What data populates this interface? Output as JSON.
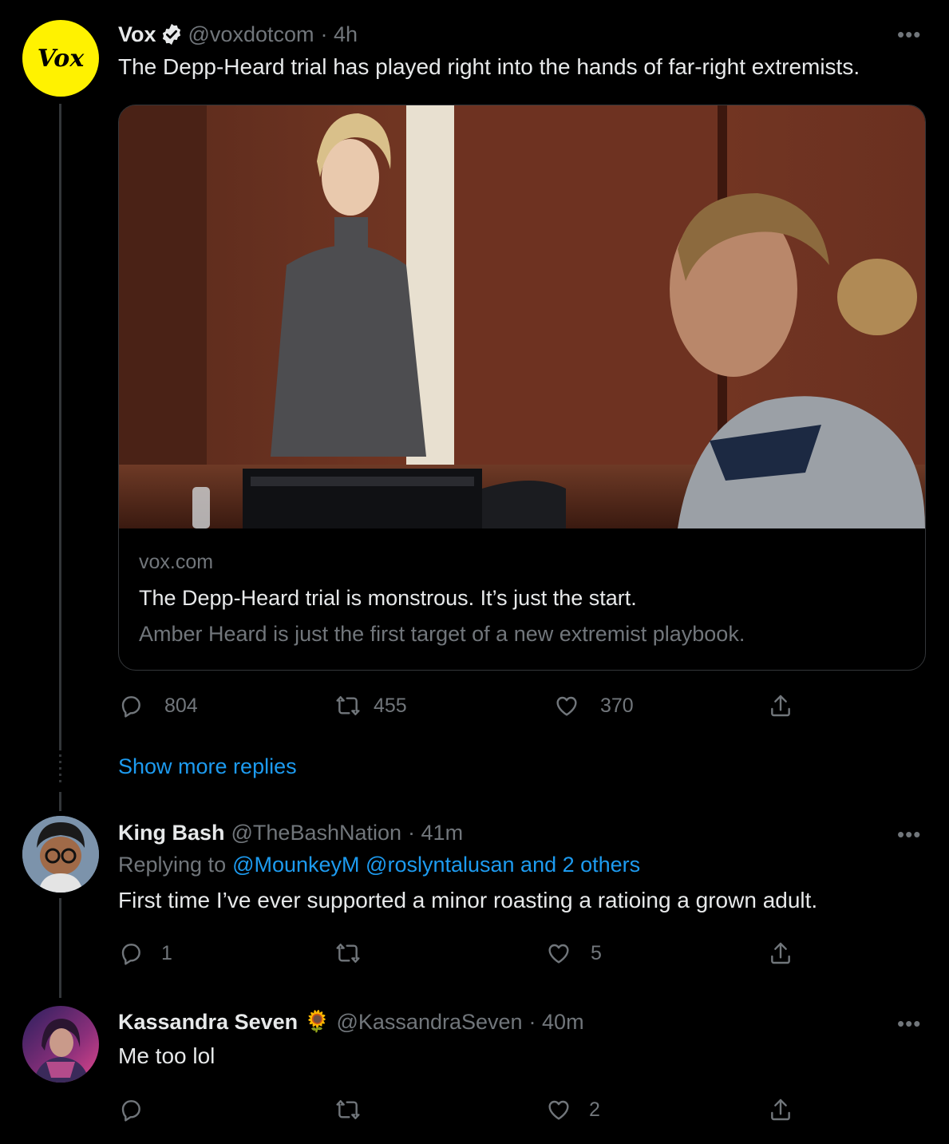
{
  "main_tweet": {
    "name": "Vox",
    "handle": "@voxdotcom",
    "time": "· 4h",
    "text": "The Depp-Heard trial has played right into the hands of far-right extremists.",
    "avatar_text": "Vox",
    "card": {
      "domain": "vox.com",
      "title": "The Depp-Heard trial is monstrous. It’s just the start.",
      "description": "Amber Heard is just the first target of a new extremist playbook."
    },
    "actions": {
      "replies": "804",
      "retweets": "455",
      "likes": "370"
    }
  },
  "show_more": "Show more replies",
  "reply1": {
    "name": "King Bash",
    "handle": "@TheBashNation",
    "time": "· 41m",
    "replying_prefix": "Replying to",
    "replying_to": "@MounkeyM @roslyntalusan and 2 others",
    "text": "First time I’ve ever supported a minor roasting a ratioing a grown adult.",
    "actions": {
      "replies": "1",
      "retweets": "",
      "likes": "5"
    }
  },
  "reply2": {
    "name": "Kassandra Seven",
    "emoji": "🌻",
    "handle": "@KassandraSeven",
    "time": "· 40m",
    "text": "Me too lol",
    "actions": {
      "replies": "",
      "retweets": "",
      "likes": "2"
    }
  },
  "more_glyph": "•••",
  "colors": {
    "accent": "#1d9bf0",
    "vox_yellow": "#fff200",
    "muted": "#71767b",
    "background": "#000000"
  },
  "icons": [
    "reply-icon",
    "retweet-icon",
    "like-icon",
    "share-icon",
    "verified-badge-icon",
    "more-icon"
  ]
}
